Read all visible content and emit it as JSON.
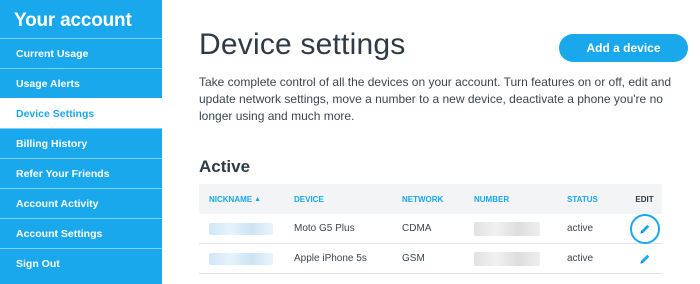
{
  "sidebar": {
    "title": "Your account",
    "items": [
      {
        "label": "Current Usage"
      },
      {
        "label": "Usage Alerts"
      },
      {
        "label": "Device Settings"
      },
      {
        "label": "Billing History"
      },
      {
        "label": "Refer Your Friends"
      },
      {
        "label": "Account Activity"
      },
      {
        "label": "Account Settings"
      },
      {
        "label": "Sign Out"
      }
    ],
    "active_item": "Device Settings"
  },
  "main": {
    "title": "Device settings",
    "add_button_label": "Add a device",
    "description": "Take complete control of all the devices on your account. Turn features on or off, edit and update network settings, move a number to a new device, deactivate a phone you're no longer using and much more.",
    "section_title": "Active"
  },
  "table": {
    "headers": {
      "nickname": "NICKNAME",
      "device": "DEVICE",
      "network": "NETWORK",
      "number": "NUMBER",
      "status": "STATUS",
      "edit": "EDIT"
    },
    "sort_indicator": "▲",
    "rows": [
      {
        "device": "Moto G5 Plus",
        "network": "CDMA",
        "status": "active"
      },
      {
        "device": "Apple iPhone 5s",
        "network": "GSM",
        "status": "active"
      }
    ]
  },
  "colors": {
    "accent": "#19a8ec",
    "text": "#2f3a44",
    "header_bg": "#f2f4f5"
  },
  "icons": {
    "edit": "pencil-icon",
    "sort": "sort-ascending-icon"
  }
}
